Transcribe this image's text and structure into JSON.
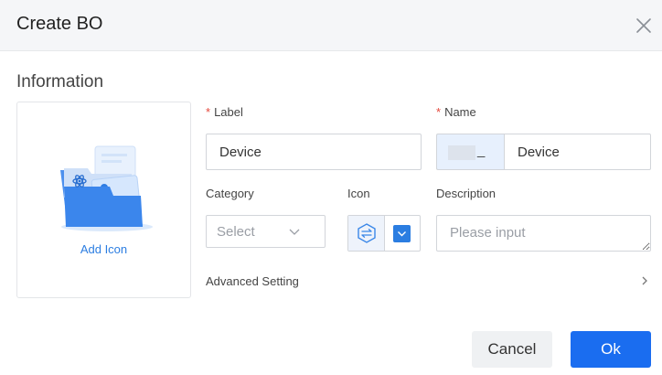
{
  "dialog": {
    "title": "Create BO",
    "section_title": "Information",
    "add_icon_label": "Add Icon",
    "fields": {
      "label": {
        "required_mark": "*",
        "label": "Label",
        "value": "Device"
      },
      "name": {
        "required_mark": "*",
        "label": "Name",
        "prefix": "_",
        "value": "Device"
      },
      "category": {
        "label": "Category",
        "placeholder": "Select"
      },
      "icon": {
        "label": "Icon",
        "selected_icon": "swap-arrows-hexagon-icon"
      },
      "description": {
        "label": "Description",
        "placeholder": "Please input"
      }
    },
    "advanced_setting": "Advanced Setting",
    "buttons": {
      "cancel": "Cancel",
      "ok": "Ok"
    }
  },
  "colors": {
    "accent": "#1a6df0",
    "link": "#2b7de1",
    "required": "#e5483d",
    "header_bg": "#f5f6f8"
  },
  "icons": {
    "close": "close-icon",
    "upload_illustration": "folder-image-icon",
    "select_chevron": "chevron-down-icon",
    "advanced_chevron": "chevron-right-icon"
  }
}
